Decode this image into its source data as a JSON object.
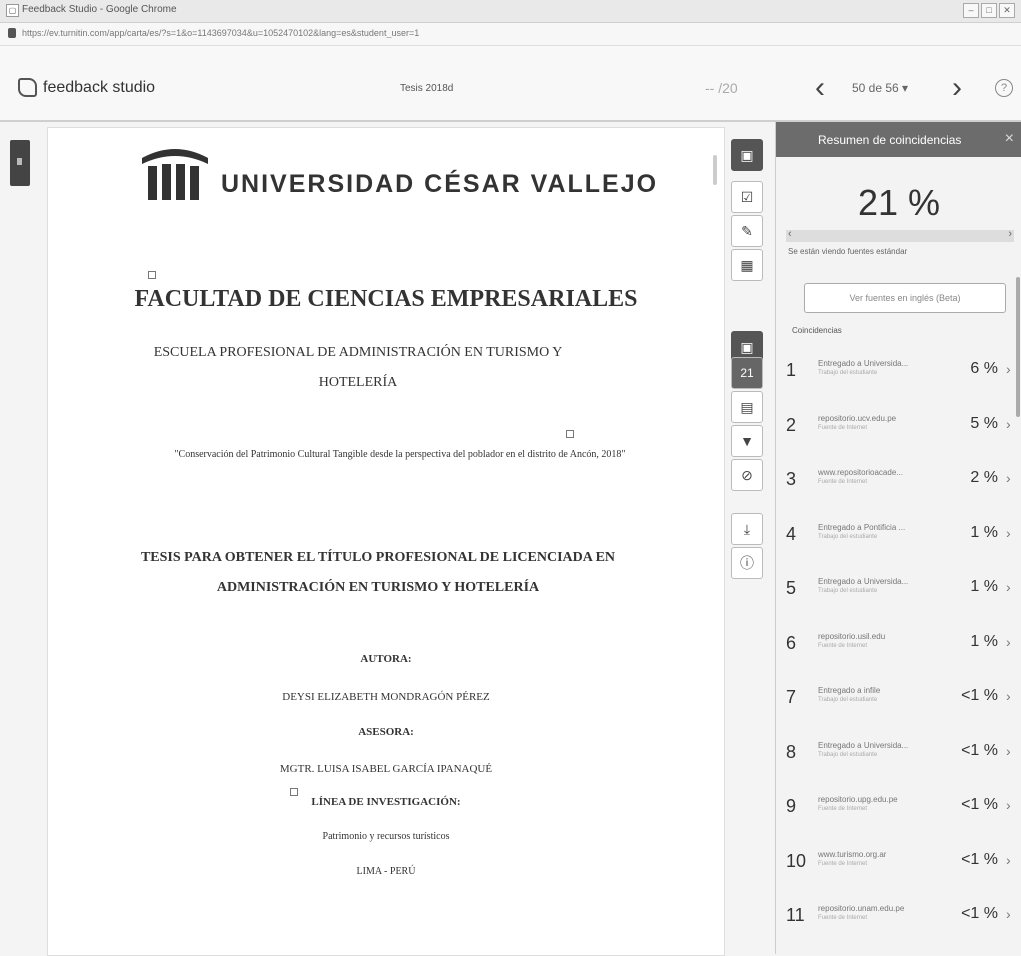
{
  "window": {
    "title": "Feedback Studio - Google Chrome"
  },
  "browser": {
    "url": "https://ev.turnitin.com/app/carta/es/?s=1&o=1143697034&u=1052470102&lang=es&student_user=1"
  },
  "app": {
    "brand": "feedback studio",
    "doc_title": "Tesis 2018d",
    "page_select": "-- /20",
    "pager": "50 de 56 ▾",
    "prev_icon": "‹",
    "next_icon": "›",
    "help_icon": "?"
  },
  "document": {
    "university": "UNIVERSIDAD CÉSAR VALLEJO",
    "faculty": "FACULTAD DE CIENCIAS EMPRESARIALES",
    "school": "ESCUELA PROFESIONAL DE ADMINISTRACIÓN EN TURISMO Y HOTELERÍA",
    "quote": "\"Conservación del Patrimonio Cultural Tangible desde la perspectiva del poblador en el distrito de Ancón, 2018\"",
    "thesis": "TESIS PARA OBTENER EL TÍTULO PROFESIONAL DE LICENCIADA EN ADMINISTRACIÓN EN TURISMO Y HOTELERÍA",
    "author_label": "AUTORA:",
    "author": "DEYSI ELIZABETH MONDRAGÓN PÉREZ",
    "advisor_label": "ASESORA:",
    "advisor": "MGTR. LUISA ISABEL GARCÍA IPANAQUÉ",
    "research_label": "LÍNEA DE INVESTIGACIÓN:",
    "research": "Patrimonio y recursos turísticos",
    "place": "LIMA - PERÚ"
  },
  "toolbar": {
    "match_count": "21"
  },
  "panel": {
    "title": "Resumen de coincidencias",
    "close": "×",
    "overall": "21 %",
    "note": "Se están viendo fuentes estándar",
    "alt_button": "Ver fuentes en inglés (Beta)",
    "section": "Coincidencias",
    "matches": [
      {
        "n": "1",
        "source": "Entregado a Universida...",
        "type": "Trabajo del estudiante",
        "pct": "6 %"
      },
      {
        "n": "2",
        "source": "repositorio.ucv.edu.pe",
        "type": "Fuente de Internet",
        "pct": "5 %"
      },
      {
        "n": "3",
        "source": "www.repositorioacade...",
        "type": "Fuente de Internet",
        "pct": "2 %"
      },
      {
        "n": "4",
        "source": "Entregado a Pontificia ...",
        "type": "Trabajo del estudiante",
        "pct": "1 %"
      },
      {
        "n": "5",
        "source": "Entregado a Universida...",
        "type": "Trabajo del estudiante",
        "pct": "1 %"
      },
      {
        "n": "6",
        "source": "repositorio.usil.edu",
        "type": "Fuente de Internet",
        "pct": "1 %"
      },
      {
        "n": "7",
        "source": "Entregado a infile",
        "type": "Trabajo del estudiante",
        "pct": "<1 %"
      },
      {
        "n": "8",
        "source": "Entregado a Universida...",
        "type": "Trabajo del estudiante",
        "pct": "<1 %"
      },
      {
        "n": "9",
        "source": "repositorio.upg.edu.pe",
        "type": "Fuente de Internet",
        "pct": "<1 %"
      },
      {
        "n": "10",
        "source": "www.turismo.org.ar",
        "type": "Fuente de Internet",
        "pct": "<1 %"
      },
      {
        "n": "11",
        "source": "repositorio.unam.edu.pe",
        "type": "Fuente de Internet",
        "pct": "<1 %"
      }
    ]
  }
}
